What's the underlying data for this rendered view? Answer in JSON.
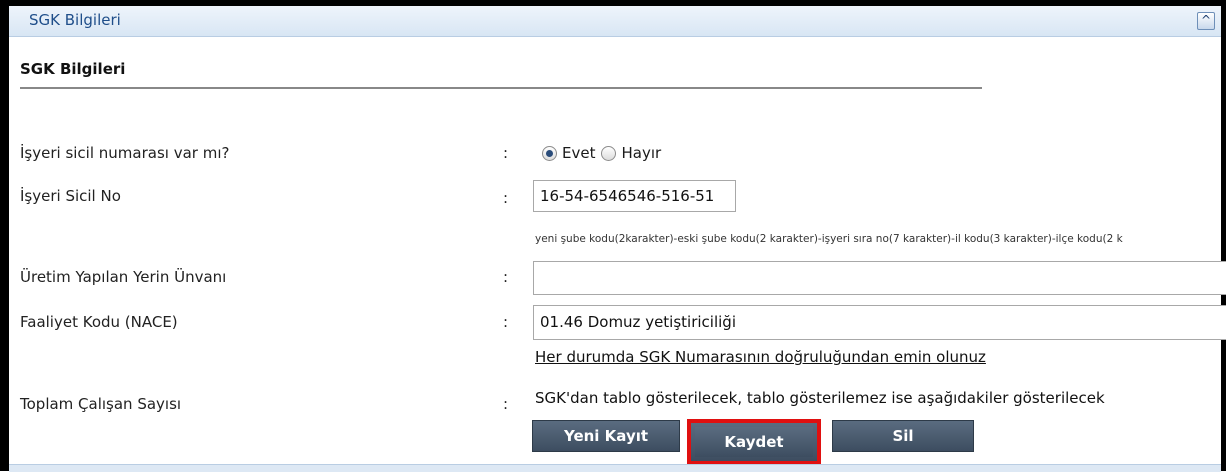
{
  "panel": {
    "header_title": "SGK Bilgileri",
    "collapse_icon": "chevron-up-icon",
    "collapse_glyph": "^"
  },
  "section": {
    "title": "SGK Bilgileri"
  },
  "form": {
    "colon": ":",
    "registry_question": {
      "label": "İşyeri sicil numarası var mı?",
      "options": [
        {
          "label": "Evet",
          "checked": true
        },
        {
          "label": "Hayır",
          "checked": false
        }
      ]
    },
    "registry_no": {
      "label": "İşyeri Sicil No",
      "value": "16-54-6546546-516-51",
      "hint": "yeni şube kodu(2karakter)-eski şube kodu(2 karakter)-işyeri sıra no(7 karakter)-il kodu(3 karakter)-ilçe kodu(2 k"
    },
    "production_place": {
      "label": "Üretim Yapılan Yerin Ünvanı",
      "value": ""
    },
    "activity_code": {
      "label": "Faaliyet Kodu (NACE)",
      "value": "01.46   Domuz yetiştiriciliği"
    },
    "notice_link": "Her durumda SGK Numarasının doğruluğundan emin olunuz",
    "employee_count": {
      "label": "Toplam Çalışan Sayısı",
      "info": "SGK'dan tablo gösterilecek, tablo gösterilemez ise aşağıdakiler gösterilecek"
    }
  },
  "buttons": {
    "new_record": "Yeni Kayıt",
    "save": "Kaydet",
    "delete": "Sil"
  },
  "colors": {
    "header_text": "#1f4e8a",
    "button_bg": "#4a5b6f",
    "highlight_border": "#e01010"
  }
}
